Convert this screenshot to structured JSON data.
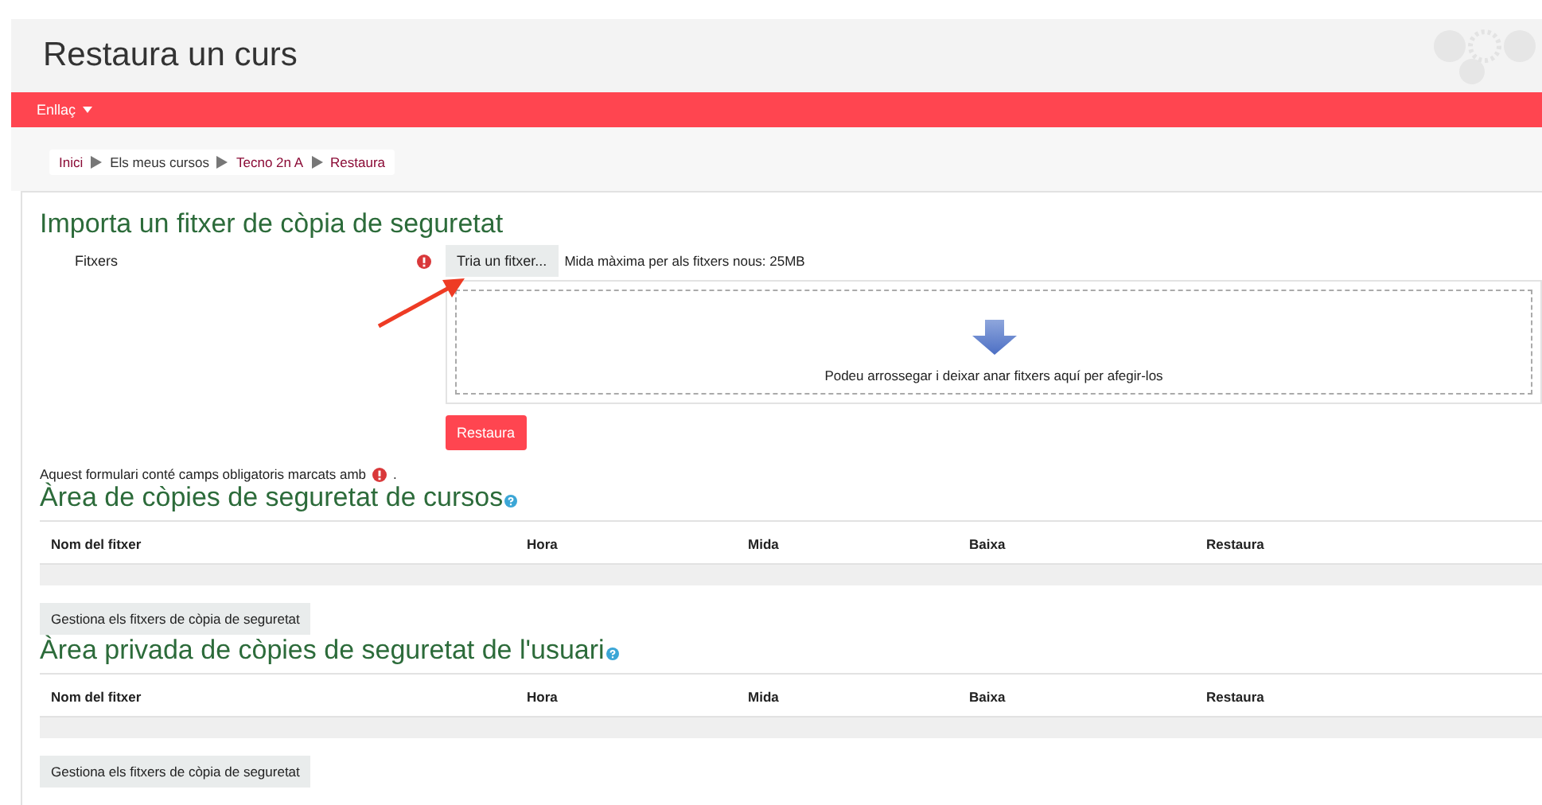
{
  "header": {
    "title": "Restaura un curs"
  },
  "navbar": {
    "menu": "Enllaç"
  },
  "breadcrumb": [
    {
      "label": "Inici",
      "kind": "link"
    },
    {
      "label": "Els meus cursos",
      "kind": "text"
    },
    {
      "label": "Tecno 2n A",
      "kind": "link"
    },
    {
      "label": "Restaura",
      "kind": "link"
    }
  ],
  "import": {
    "heading": "Importa un fitxer de còpia de seguretat",
    "field_label": "Fitxers",
    "choose_button": "Tria un fitxer...",
    "max_size": "Mida màxima per als fitxers nous: 25MB",
    "drop_hint": "Podeu arrossegar i deixar anar fitxers aquí per afegir-los",
    "submit_button": "Restaura",
    "required_note": "Aquest formulari conté camps obligatoris marcats amb",
    "required_note_end": "."
  },
  "areas": [
    {
      "heading": "Àrea de còpies de seguretat de cursos",
      "columns": [
        "Nom del fitxer",
        "Hora",
        "Mida",
        "Baixa",
        "Restaura"
      ],
      "button": "Gestiona els fitxers de còpia de seguretat"
    },
    {
      "heading": "Àrea privada de còpies de seguretat de l'usuari",
      "columns": [
        "Nom del fitxer",
        "Hora",
        "Mida",
        "Baixa",
        "Restaura"
      ],
      "button": "Gestiona els fitxers de còpia de seguretat"
    }
  ]
}
